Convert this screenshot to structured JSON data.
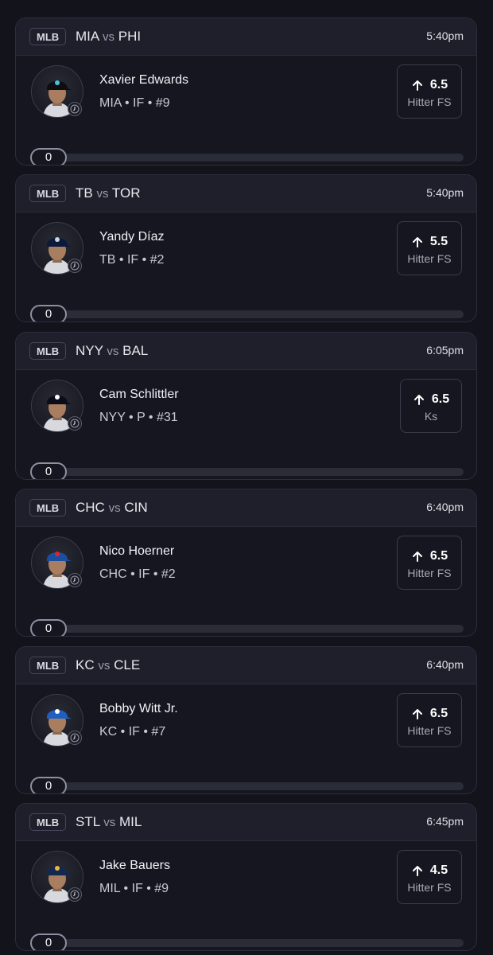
{
  "cards": [
    {
      "league": "MLB",
      "away": "MIA",
      "vs": "vs",
      "home": "PHI",
      "time": "5:40pm",
      "player": "Xavier Edwards",
      "meta": "MIA • IF • #9",
      "value": "6.5",
      "stat": "Hitter FS",
      "progress": "0",
      "cap_color": "#0e0e12",
      "logo_color": "#41c6d8"
    },
    {
      "league": "MLB",
      "away": "TB",
      "vs": "vs",
      "home": "TOR",
      "time": "5:40pm",
      "player": "Yandy Díaz",
      "meta": "TB • IF • #2",
      "value": "5.5",
      "stat": "Hitter FS",
      "progress": "0",
      "cap_color": "#0b1a3a",
      "logo_color": "#c9d4e6"
    },
    {
      "league": "MLB",
      "away": "NYY",
      "vs": "vs",
      "home": "BAL",
      "time": "6:05pm",
      "player": "Cam Schlittler",
      "meta": "NYY • P • #31",
      "value": "6.5",
      "stat": "Ks",
      "progress": "0",
      "cap_color": "#0a0c18",
      "logo_color": "#ffffff"
    },
    {
      "league": "MLB",
      "away": "CHC",
      "vs": "vs",
      "home": "CIN",
      "time": "6:40pm",
      "player": "Nico Hoerner",
      "meta": "CHC • IF • #2",
      "value": "6.5",
      "stat": "Hitter FS",
      "progress": "0",
      "cap_color": "#1a4ea0",
      "logo_color": "#d8262f"
    },
    {
      "league": "MLB",
      "away": "KC",
      "vs": "vs",
      "home": "CLE",
      "time": "6:40pm",
      "player": "Bobby Witt Jr.",
      "meta": "KC • IF • #7",
      "value": "6.5",
      "stat": "Hitter FS",
      "progress": "0",
      "cap_color": "#1e5fc2",
      "logo_color": "#ffffff"
    },
    {
      "league": "MLB",
      "away": "STL",
      "vs": "vs",
      "home": "MIL",
      "time": "6:45pm",
      "player": "Jake Bauers",
      "meta": "MIL • IF • #9",
      "value": "4.5",
      "stat": "Hitter FS",
      "progress": "0",
      "cap_color": "#13284f",
      "logo_color": "#e6b845"
    }
  ]
}
